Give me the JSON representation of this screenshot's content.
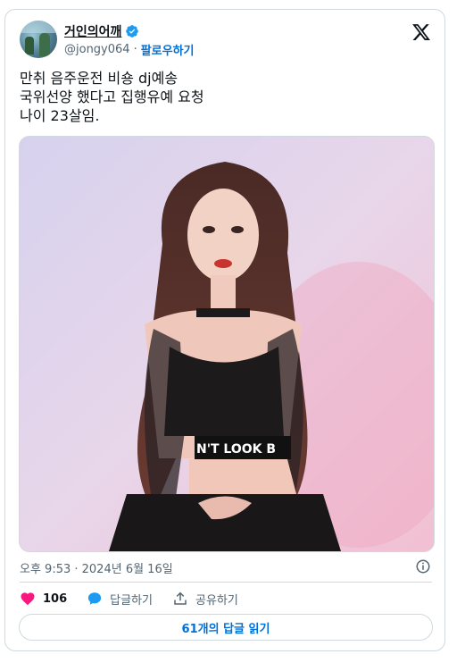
{
  "tweet": {
    "display_name": "거인의어깨",
    "handle": "@jongy064",
    "separator": "·",
    "follow_label": "팔로우하기",
    "text": "만취 음주운전 비숑 dj예송\n국위선양 했다고 집행유예 요청\n나이 23살임.",
    "timestamp": "오후 9:53 · 2024년 6월 16일"
  },
  "image": {
    "alt_description": "photo",
    "shirt_text": "N'T LOOK B"
  },
  "actions": {
    "like_count": "106",
    "reply_label": "답글하기",
    "share_label": "공유하기"
  },
  "replies_button": {
    "label": "61개의 답글 읽기"
  },
  "colors": {
    "accent": "#1d9bf0",
    "link": "#006fd6",
    "like": "#f91880",
    "muted": "#536471",
    "border": "#cfd9de"
  },
  "icons": {
    "logo": "x-logo-icon",
    "verified": "verified-badge-icon",
    "info": "info-icon",
    "like": "heart-icon",
    "reply": "speech-bubble-icon",
    "share": "share-upload-icon"
  }
}
